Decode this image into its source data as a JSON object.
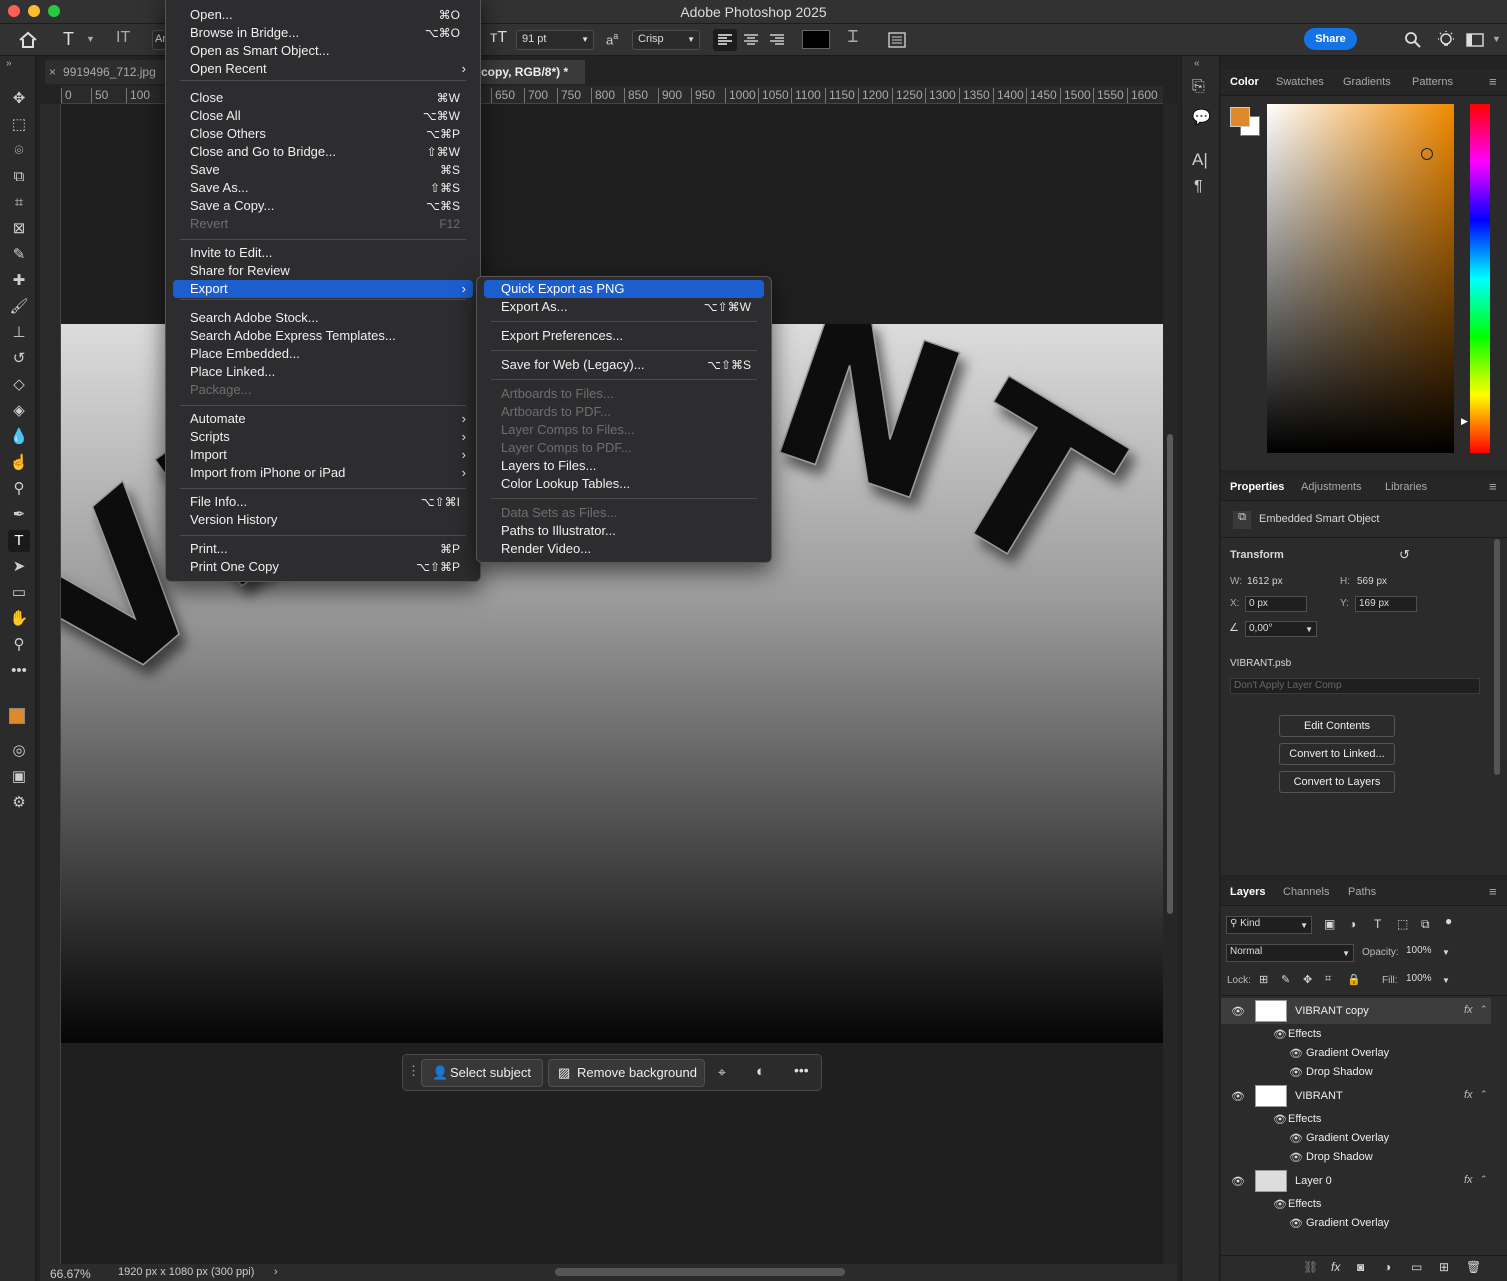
{
  "app": {
    "title": "Adobe Photoshop 2025"
  },
  "options": {
    "font_abbrev": "Ar",
    "size": "91 pt",
    "aa_label": "a",
    "antialias": "Crisp",
    "share": "Share"
  },
  "document": {
    "tab_inactive": "9919496_712.jpg",
    "tab_active_partial": "copy, RGB/8*) *",
    "zoom": "66.67%",
    "dimensions": "1920 px x 1080 px (300 ppi)",
    "artwork_text": "VIBRANT"
  },
  "ruler": {
    "h_ticks": [
      "0",
      "50",
      "100",
      "650",
      "700",
      "750",
      "800",
      "850",
      "900",
      "950",
      "1000",
      "1050",
      "1100",
      "1150",
      "1200",
      "1250",
      "1300",
      "1350",
      "1400",
      "1450",
      "1500",
      "1550",
      "1600"
    ]
  },
  "file_menu": {
    "items": [
      {
        "label": "Open...",
        "shortcut": "⌘O"
      },
      {
        "label": "Browse in Bridge...",
        "shortcut": "⌥⌘O"
      },
      {
        "label": "Open as Smart Object..."
      },
      {
        "label": "Open Recent",
        "submenu": true
      },
      {
        "label": "Close",
        "shortcut": "⌘W"
      },
      {
        "label": "Close All",
        "shortcut": "⌥⌘W"
      },
      {
        "label": "Close Others",
        "shortcut": "⌥⌘P"
      },
      {
        "label": "Close and Go to Bridge...",
        "shortcut": "⇧⌘W"
      },
      {
        "label": "Save",
        "shortcut": "⌘S"
      },
      {
        "label": "Save As...",
        "shortcut": "⇧⌘S"
      },
      {
        "label": "Save a Copy...",
        "shortcut": "⌥⌘S"
      },
      {
        "label": "Revert",
        "shortcut": "F12",
        "disabled": true
      },
      {
        "label": "Invite to Edit..."
      },
      {
        "label": "Share for Review"
      },
      {
        "label": "Export",
        "submenu": true,
        "highlighted": true
      },
      {
        "label": "Search Adobe Stock..."
      },
      {
        "label": "Search Adobe Express Templates..."
      },
      {
        "label": "Place Embedded..."
      },
      {
        "label": "Place Linked..."
      },
      {
        "label": "Package...",
        "disabled": true
      },
      {
        "label": "Automate",
        "submenu": true
      },
      {
        "label": "Scripts",
        "submenu": true
      },
      {
        "label": "Import",
        "submenu": true
      },
      {
        "label": "Import from iPhone or iPad",
        "submenu": true
      },
      {
        "label": "File Info...",
        "shortcut": "⌥⇧⌘I"
      },
      {
        "label": "Version History"
      },
      {
        "label": "Print...",
        "shortcut": "⌘P"
      },
      {
        "label": "Print One Copy",
        "shortcut": "⌥⇧⌘P"
      }
    ]
  },
  "export_menu": {
    "items": [
      {
        "label": "Quick Export as PNG",
        "highlighted": true
      },
      {
        "label": "Export As...",
        "shortcut": "⌥⇧⌘W"
      },
      {
        "label": "Export Preferences..."
      },
      {
        "label": "Save for Web (Legacy)...",
        "shortcut": "⌥⇧⌘S"
      },
      {
        "label": "Artboards to Files...",
        "disabled": true
      },
      {
        "label": "Artboards to PDF...",
        "disabled": true
      },
      {
        "label": "Layer Comps to Files...",
        "disabled": true
      },
      {
        "label": "Layer Comps to PDF...",
        "disabled": true
      },
      {
        "label": "Layers to Files..."
      },
      {
        "label": "Color Lookup Tables..."
      },
      {
        "label": "Data Sets as Files...",
        "disabled": true
      },
      {
        "label": "Paths to Illustrator..."
      },
      {
        "label": "Render Video..."
      }
    ]
  },
  "context_bar": {
    "select_subject": "Select subject",
    "remove_background": "Remove background"
  },
  "color_panel": {
    "tabs": [
      "Color",
      "Swatches",
      "Gradients",
      "Patterns"
    ],
    "foreground": "#e0892a",
    "background": "#ffffff"
  },
  "properties_panel": {
    "tabs": [
      "Properties",
      "Adjustments",
      "Libraries"
    ],
    "kind": "Embedded Smart Object",
    "transform_label": "Transform",
    "w_label": "W:",
    "w": "1612 px",
    "h_label": "H:",
    "h": "569 px",
    "x_label": "X:",
    "x": "0 px",
    "y_label": "Y:",
    "y": "169 px",
    "angle": "0,00°",
    "file": "VIBRANT.psb",
    "layer_comp": "Don't Apply Layer Comp",
    "buttons": [
      "Edit Contents",
      "Convert to Linked...",
      "Convert to Layers"
    ]
  },
  "layers_panel": {
    "tabs": [
      "Layers",
      "Channels",
      "Paths"
    ],
    "filter": "Kind",
    "blend": "Normal",
    "opacity_label": "Opacity:",
    "opacity": "100%",
    "lock_label": "Lock:",
    "fill_label": "Fill:",
    "fill": "100%",
    "layers": [
      {
        "name": "VIBRANT copy",
        "effects_label": "Effects",
        "effects": [
          "Gradient Overlay",
          "Drop Shadow"
        ]
      },
      {
        "name": "VIBRANT",
        "effects_label": "Effects",
        "effects": [
          "Gradient Overlay",
          "Drop Shadow"
        ]
      },
      {
        "name": "Layer 0",
        "effects_label": "Effects",
        "effects": [
          "Gradient Overlay"
        ]
      }
    ]
  }
}
